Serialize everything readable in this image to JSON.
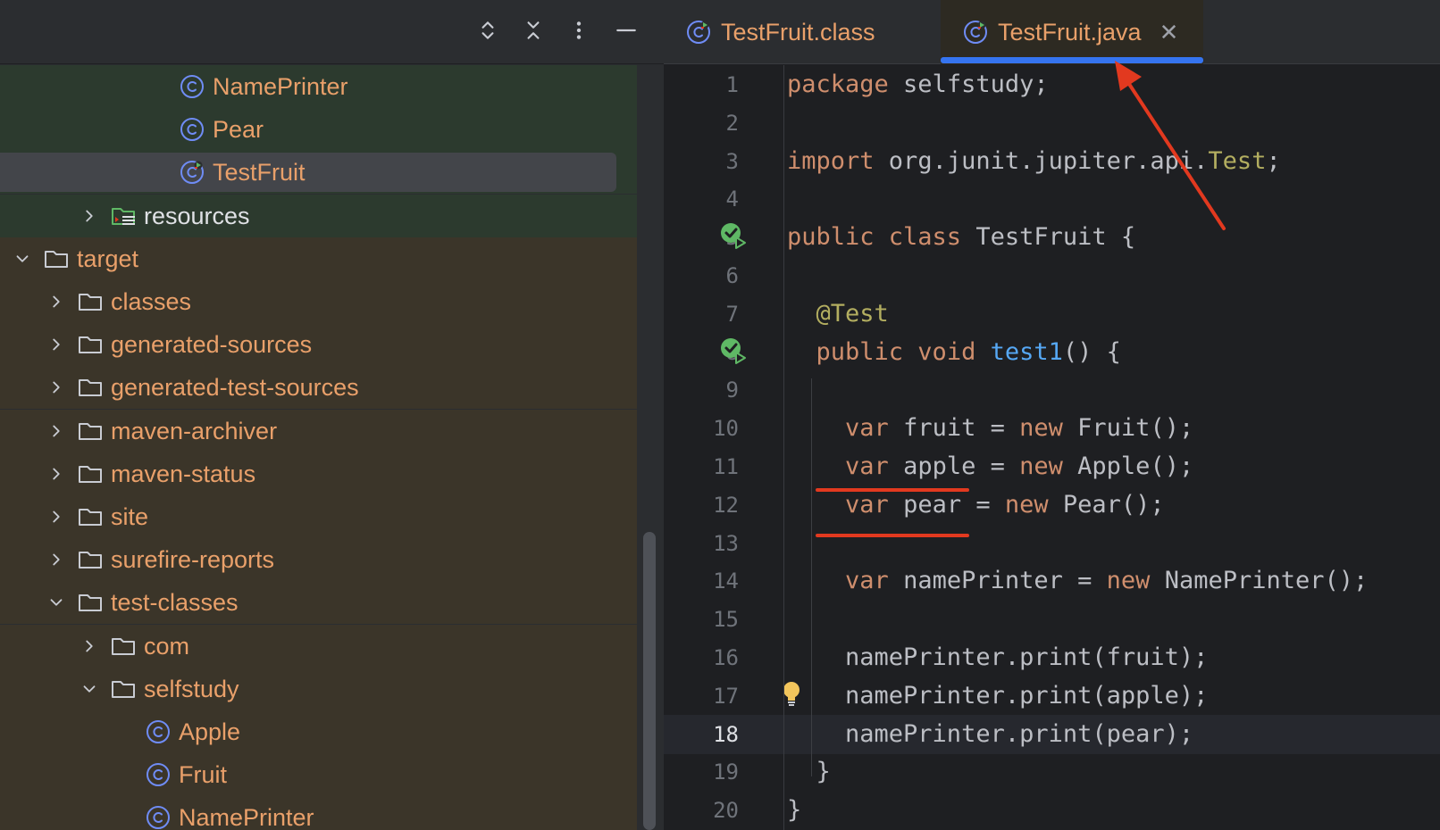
{
  "toolbar": {
    "icons": [
      "expand-icon",
      "collapse-icon",
      "more-icon",
      "minimize-icon"
    ]
  },
  "tree": [
    {
      "label": "NamePrinter",
      "kind": "class",
      "level": 5,
      "bg": "green"
    },
    {
      "label": "Pear",
      "kind": "class",
      "level": 5,
      "bg": "green"
    },
    {
      "label": "TestFruit",
      "kind": "test-class",
      "level": 5,
      "bg": "green",
      "selected": true
    },
    {
      "label": "resources",
      "kind": "resources",
      "level": 2,
      "bg": "green",
      "chevron": "right",
      "light": true
    },
    {
      "label": "target",
      "kind": "folder",
      "level": 0,
      "bg": "brown",
      "chevron": "down"
    },
    {
      "label": "classes",
      "kind": "folder",
      "level": 1,
      "bg": "brown",
      "chevron": "right"
    },
    {
      "label": "generated-sources",
      "kind": "folder",
      "level": 1,
      "bg": "brown",
      "chevron": "right"
    },
    {
      "label": "generated-test-sources",
      "kind": "folder",
      "level": 1,
      "bg": "brown",
      "chevron": "right"
    },
    {
      "label": "maven-archiver",
      "kind": "folder",
      "level": 1,
      "bg": "brown",
      "chevron": "right"
    },
    {
      "label": "maven-status",
      "kind": "folder",
      "level": 1,
      "bg": "brown",
      "chevron": "right"
    },
    {
      "label": "site",
      "kind": "folder",
      "level": 1,
      "bg": "brown",
      "chevron": "right"
    },
    {
      "label": "surefire-reports",
      "kind": "folder",
      "level": 1,
      "bg": "brown",
      "chevron": "right"
    },
    {
      "label": "test-classes",
      "kind": "folder",
      "level": 1,
      "bg": "brown",
      "chevron": "down"
    },
    {
      "label": "com",
      "kind": "folder",
      "level": 2,
      "bg": "brown",
      "chevron": "right"
    },
    {
      "label": "selfstudy",
      "kind": "folder",
      "level": 2,
      "bg": "brown",
      "chevron": "down"
    },
    {
      "label": "Apple",
      "kind": "class",
      "level": 4,
      "bg": "brown"
    },
    {
      "label": "Fruit",
      "kind": "class",
      "level": 4,
      "bg": "brown"
    },
    {
      "label": "NamePrinter",
      "kind": "class",
      "level": 4,
      "bg": "brown"
    }
  ],
  "tabs": [
    {
      "label": "TestFruit.class",
      "active": false
    },
    {
      "label": "TestFruit.java",
      "active": true,
      "close": "✕"
    }
  ],
  "editor": {
    "current_line": 18,
    "lines": [
      {
        "n": "1",
        "tokens": [
          [
            "kw",
            "package"
          ],
          [
            "p",
            " selfstudy;"
          ]
        ]
      },
      {
        "n": "2",
        "tokens": []
      },
      {
        "n": "3",
        "tokens": [
          [
            "kw",
            "import"
          ],
          [
            "p",
            " org.junit.jupiter.api."
          ],
          [
            "ann",
            "Test"
          ],
          [
            "p",
            ";"
          ]
        ]
      },
      {
        "n": "4",
        "tokens": []
      },
      {
        "n": "5",
        "tokens": [
          [
            "kw",
            "public class"
          ],
          [
            "p",
            " TestFruit {"
          ]
        ],
        "run": true
      },
      {
        "n": "6",
        "tokens": []
      },
      {
        "n": "7",
        "tokens": [
          [
            "p",
            "  "
          ],
          [
            "ann",
            "@Test"
          ]
        ]
      },
      {
        "n": "8",
        "tokens": [
          [
            "p",
            "  "
          ],
          [
            "kw",
            "public void"
          ],
          [
            "p",
            " "
          ],
          [
            "fn",
            "test1"
          ],
          [
            "p",
            "() {"
          ]
        ],
        "run": true
      },
      {
        "n": "9",
        "tokens": []
      },
      {
        "n": "10",
        "tokens": [
          [
            "p",
            "    "
          ],
          [
            "kw",
            "var"
          ],
          [
            "p",
            " fruit = "
          ],
          [
            "kw",
            "new"
          ],
          [
            "p",
            " Fruit();"
          ]
        ]
      },
      {
        "n": "11",
        "tokens": [
          [
            "p",
            "    "
          ],
          [
            "kw",
            "var"
          ],
          [
            "p",
            " apple = "
          ],
          [
            "kw",
            "new"
          ],
          [
            "p",
            " Apple();"
          ]
        ]
      },
      {
        "n": "12",
        "tokens": [
          [
            "p",
            "    "
          ],
          [
            "kw",
            "var"
          ],
          [
            "p",
            " pear = "
          ],
          [
            "kw",
            "new"
          ],
          [
            "p",
            " Pear();"
          ]
        ]
      },
      {
        "n": "13",
        "tokens": []
      },
      {
        "n": "14",
        "tokens": [
          [
            "p",
            "    "
          ],
          [
            "kw",
            "var"
          ],
          [
            "p",
            " namePrinter = "
          ],
          [
            "kw",
            "new"
          ],
          [
            "p",
            " NamePrinter();"
          ]
        ]
      },
      {
        "n": "15",
        "tokens": []
      },
      {
        "n": "16",
        "tokens": [
          [
            "p",
            "    namePrinter.print(fruit);"
          ]
        ]
      },
      {
        "n": "17",
        "tokens": [
          [
            "p",
            "    namePrinter.print(apple);"
          ]
        ],
        "bulb": true
      },
      {
        "n": "18",
        "tokens": [
          [
            "p",
            "    namePrinter.print(pear);"
          ]
        ]
      },
      {
        "n": "19",
        "tokens": [
          [
            "p",
            "  }"
          ]
        ]
      },
      {
        "n": "20",
        "tokens": [
          [
            "p",
            "}"
          ]
        ]
      }
    ]
  },
  "colors": {
    "accent": "#3574f0",
    "class_icon": "#6f8cf5",
    "annotation_red": "#e2391f",
    "run_green": "#5fb865"
  }
}
